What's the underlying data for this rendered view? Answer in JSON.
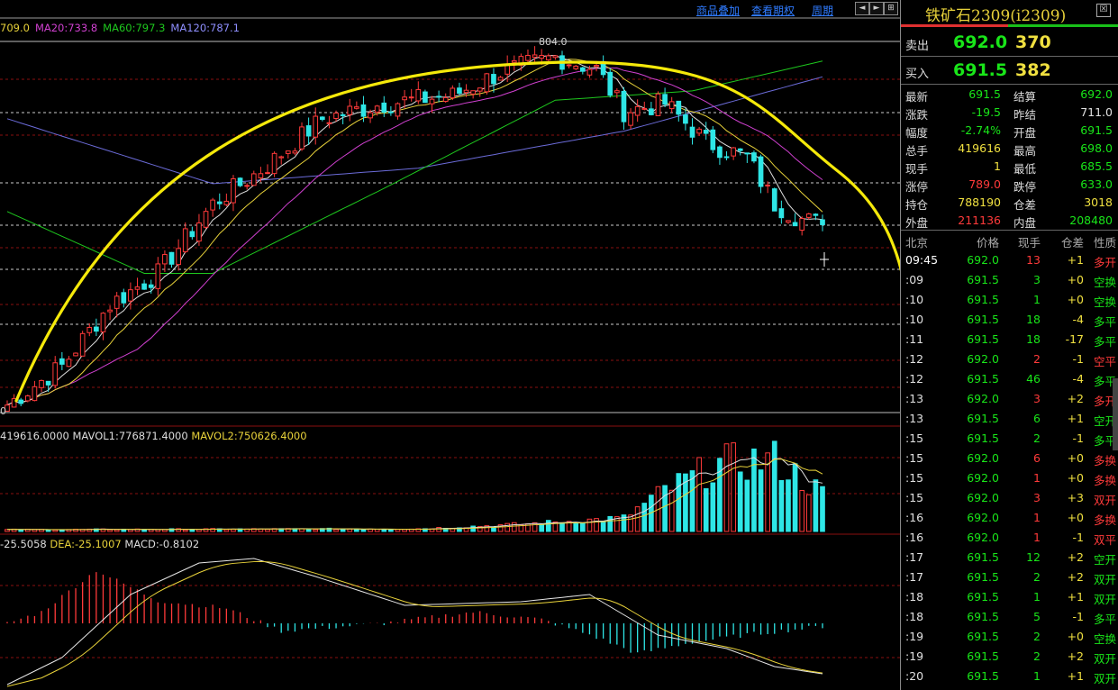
{
  "toolbar": {
    "overlay_label": "商品叠加",
    "history_label": "查看期权",
    "period_label": "周期",
    "nav_left": "◄",
    "nav_right": "►",
    "nav_end": "⊞"
  },
  "ma_legend": {
    "ma5": "709.0",
    "ma20": "MA20:733.8",
    "ma60": "MA60:797.3",
    "ma120": "MA120:787.1"
  },
  "price_chart": {
    "peak_label": "804.0",
    "low_label": "0"
  },
  "volume_legend": {
    "vol": "419616.0000",
    "mavol1": "MAVOL1:776871.4000",
    "mavol2": "MAVOL2:750626.4000"
  },
  "macd_legend": {
    "dif": "-25.5058",
    "dea": "DEA:-25.1007",
    "macd": "MACD:-0.8102"
  },
  "colors": {
    "up": "#ff3a3a",
    "down": "#2ee6e6",
    "ma5": "#e0e0e0",
    "ma10": "#e8d23a",
    "ma20": "#d040d0",
    "ma60": "#1ec81e",
    "ma120": "#6b6bd8",
    "annotation": "#f5e90a",
    "grid": "#8a1010",
    "panel_green": "#19e519",
    "panel_red": "#ff3a3a",
    "panel_yellow": "#f0e040"
  },
  "panel": {
    "title": "铁矿石2309(i2309)",
    "close_icon": "☒",
    "ask": {
      "label": "卖出",
      "price": "692.0",
      "volume": "370"
    },
    "bid": {
      "label": "买入",
      "price": "691.5",
      "volume": "382"
    },
    "stats": [
      {
        "l1": "最新",
        "v1": "691.5",
        "c1": "green",
        "l2": "结算",
        "v2": "692.0",
        "c2": "green"
      },
      {
        "l1": "涨跌",
        "v1": "-19.5",
        "c1": "green",
        "l2": "昨结",
        "v2": "711.0",
        "c2": "white"
      },
      {
        "l1": "幅度",
        "v1": "-2.74%",
        "c1": "green",
        "l2": "开盘",
        "v2": "691.5",
        "c2": "green"
      },
      {
        "l1": "总手",
        "v1": "419616",
        "c1": "yellow",
        "l2": "最高",
        "v2": "698.0",
        "c2": "green"
      },
      {
        "l1": "现手",
        "v1": "1",
        "c1": "yellow",
        "l2": "最低",
        "v2": "685.5",
        "c2": "green"
      },
      {
        "l1": "涨停",
        "v1": "789.0",
        "c1": "red",
        "l2": "跌停",
        "v2": "633.0",
        "c2": "green"
      },
      {
        "l1": "持仓",
        "v1": "788190",
        "c1": "yellow",
        "l2": "仓差",
        "v2": "3018",
        "c2": "yellow"
      },
      {
        "l1": "外盘",
        "v1": "211136",
        "c1": "red",
        "l2": "内盘",
        "v2": "208480",
        "c2": "green"
      }
    ],
    "tick_header": {
      "time": "北京",
      "price": "价格",
      "vol": "现手",
      "oi": "仓差",
      "nature": "性质"
    },
    "ticks": [
      {
        "time": "09:45",
        "price": "692.0",
        "pc": "green",
        "vol": "13",
        "vc": "red",
        "oi": "+1",
        "oc": "yellow",
        "nature": "多开",
        "nc": "red"
      },
      {
        "time": ":09",
        "price": "691.5",
        "pc": "green",
        "vol": "3",
        "vc": "green",
        "oi": "+0",
        "oc": "yellow",
        "nature": "空换",
        "nc": "green"
      },
      {
        "time": ":10",
        "price": "691.5",
        "pc": "green",
        "vol": "1",
        "vc": "green",
        "oi": "+0",
        "oc": "yellow",
        "nature": "空换",
        "nc": "green"
      },
      {
        "time": ":10",
        "price": "691.5",
        "pc": "green",
        "vol": "18",
        "vc": "green",
        "oi": "-4",
        "oc": "yellow",
        "nature": "多平",
        "nc": "green"
      },
      {
        "time": ":11",
        "price": "691.5",
        "pc": "green",
        "vol": "18",
        "vc": "green",
        "oi": "-17",
        "oc": "yellow",
        "nature": "多平",
        "nc": "green"
      },
      {
        "time": ":12",
        "price": "692.0",
        "pc": "green",
        "vol": "2",
        "vc": "red",
        "oi": "-1",
        "oc": "yellow",
        "nature": "空平",
        "nc": "red"
      },
      {
        "time": ":12",
        "price": "691.5",
        "pc": "green",
        "vol": "46",
        "vc": "green",
        "oi": "-4",
        "oc": "yellow",
        "nature": "多平",
        "nc": "green"
      },
      {
        "time": ":13",
        "price": "692.0",
        "pc": "green",
        "vol": "3",
        "vc": "red",
        "oi": "+2",
        "oc": "yellow",
        "nature": "多开",
        "nc": "red"
      },
      {
        "time": ":13",
        "price": "691.5",
        "pc": "green",
        "vol": "6",
        "vc": "green",
        "oi": "+1",
        "oc": "yellow",
        "nature": "空开",
        "nc": "green"
      },
      {
        "time": ":15",
        "price": "691.5",
        "pc": "green",
        "vol": "2",
        "vc": "green",
        "oi": "-1",
        "oc": "yellow",
        "nature": "多平",
        "nc": "green"
      },
      {
        "time": ":15",
        "price": "692.0",
        "pc": "green",
        "vol": "6",
        "vc": "red",
        "oi": "+0",
        "oc": "yellow",
        "nature": "多换",
        "nc": "red"
      },
      {
        "time": ":15",
        "price": "692.0",
        "pc": "green",
        "vol": "1",
        "vc": "red",
        "oi": "+0",
        "oc": "yellow",
        "nature": "多换",
        "nc": "red"
      },
      {
        "time": ":15",
        "price": "692.0",
        "pc": "green",
        "vol": "3",
        "vc": "red",
        "oi": "+3",
        "oc": "yellow",
        "nature": "双开",
        "nc": "red"
      },
      {
        "time": ":16",
        "price": "692.0",
        "pc": "green",
        "vol": "1",
        "vc": "red",
        "oi": "+0",
        "oc": "yellow",
        "nature": "多换",
        "nc": "red"
      },
      {
        "time": ":16",
        "price": "692.0",
        "pc": "green",
        "vol": "1",
        "vc": "red",
        "oi": "-1",
        "oc": "yellow",
        "nature": "双平",
        "nc": "red"
      },
      {
        "time": ":17",
        "price": "691.5",
        "pc": "green",
        "vol": "12",
        "vc": "green",
        "oi": "+2",
        "oc": "yellow",
        "nature": "空开",
        "nc": "green"
      },
      {
        "time": ":17",
        "price": "691.5",
        "pc": "green",
        "vol": "2",
        "vc": "green",
        "oi": "+2",
        "oc": "yellow",
        "nature": "双开",
        "nc": "green"
      },
      {
        "time": ":18",
        "price": "691.5",
        "pc": "green",
        "vol": "1",
        "vc": "green",
        "oi": "+1",
        "oc": "yellow",
        "nature": "双开",
        "nc": "green"
      },
      {
        "time": ":18",
        "price": "691.5",
        "pc": "green",
        "vol": "5",
        "vc": "green",
        "oi": "-1",
        "oc": "yellow",
        "nature": "多平",
        "nc": "green"
      },
      {
        "time": ":19",
        "price": "691.5",
        "pc": "green",
        "vol": "2",
        "vc": "green",
        "oi": "+0",
        "oc": "yellow",
        "nature": "空换",
        "nc": "green"
      },
      {
        "time": ":19",
        "price": "691.5",
        "pc": "green",
        "vol": "2",
        "vc": "green",
        "oi": "+2",
        "oc": "yellow",
        "nature": "双开",
        "nc": "green"
      },
      {
        "time": ":20",
        "price": "691.5",
        "pc": "green",
        "vol": "1",
        "vc": "green",
        "oi": "+1",
        "oc": "yellow",
        "nature": "双开",
        "nc": "green"
      }
    ]
  },
  "chart_data": {
    "type": "candlestick",
    "series_count": 120,
    "price_close_shape": [
      {
        "i": 0,
        "v": 575
      },
      {
        "i": 8,
        "v": 600
      },
      {
        "i": 15,
        "v": 640
      },
      {
        "i": 22,
        "v": 660
      },
      {
        "i": 30,
        "v": 705
      },
      {
        "i": 38,
        "v": 730
      },
      {
        "i": 46,
        "v": 760
      },
      {
        "i": 55,
        "v": 770
      },
      {
        "i": 65,
        "v": 775
      },
      {
        "i": 72,
        "v": 790
      },
      {
        "i": 80,
        "v": 800
      },
      {
        "i": 86,
        "v": 792
      },
      {
        "i": 90,
        "v": 765
      },
      {
        "i": 96,
        "v": 770
      },
      {
        "i": 102,
        "v": 745
      },
      {
        "i": 108,
        "v": 735
      },
      {
        "i": 112,
        "v": 705
      },
      {
        "i": 116,
        "v": 695
      },
      {
        "i": 119,
        "v": 691.5
      }
    ],
    "price_range": [
      570,
      810
    ],
    "ma": {
      "ma120": [
        {
          "i": 0,
          "v": 760
        },
        {
          "i": 30,
          "v": 718
        },
        {
          "i": 60,
          "v": 728
        },
        {
          "i": 90,
          "v": 752
        },
        {
          "i": 119,
          "v": 787.1
        }
      ],
      "ma60": [
        {
          "i": 0,
          "v": 700
        },
        {
          "i": 20,
          "v": 660
        },
        {
          "i": 30,
          "v": 660
        },
        {
          "i": 55,
          "v": 715
        },
        {
          "i": 80,
          "v": 772
        },
        {
          "i": 100,
          "v": 778
        },
        {
          "i": 119,
          "v": 797.3
        }
      ]
    },
    "volume_profile": [
      {
        "i": 0,
        "v": 0.02
      },
      {
        "i": 60,
        "v": 0.03
      },
      {
        "i": 75,
        "v": 0.08
      },
      {
        "i": 90,
        "v": 0.15
      },
      {
        "i": 96,
        "v": 0.45
      },
      {
        "i": 104,
        "v": 0.75
      },
      {
        "i": 112,
        "v": 0.8
      },
      {
        "i": 119,
        "v": 0.42
      }
    ],
    "macd_profile": [
      {
        "i": 0,
        "v": 0
      },
      {
        "i": 5,
        "v": 3
      },
      {
        "i": 13,
        "v": 14
      },
      {
        "i": 22,
        "v": 6
      },
      {
        "i": 32,
        "v": 4
      },
      {
        "i": 40,
        "v": -2
      },
      {
        "i": 55,
        "v": 0
      },
      {
        "i": 68,
        "v": 3
      },
      {
        "i": 78,
        "v": 1
      },
      {
        "i": 85,
        "v": -3
      },
      {
        "i": 92,
        "v": -8
      },
      {
        "i": 100,
        "v": -5
      },
      {
        "i": 108,
        "v": -3
      },
      {
        "i": 119,
        "v": -0.8
      }
    ]
  }
}
